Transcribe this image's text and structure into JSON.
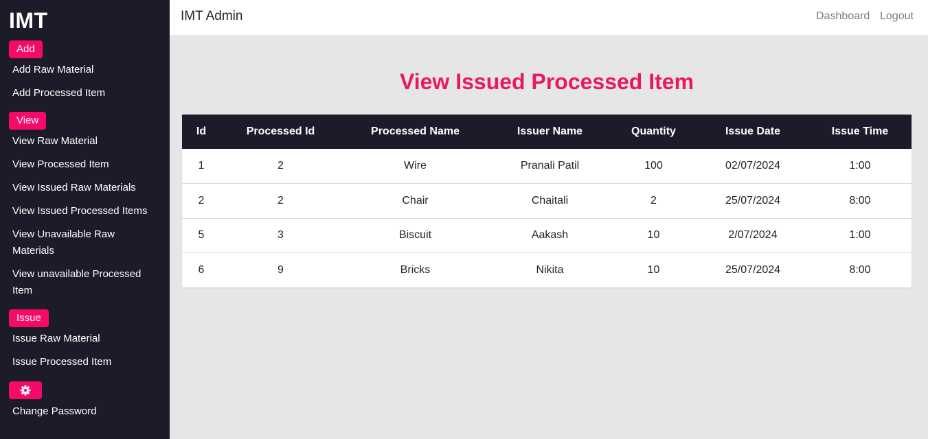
{
  "sidebar": {
    "brand": "IMT",
    "sections": {
      "add": {
        "badge": "Add",
        "items": [
          "Add Raw Material",
          "Add Processed Item"
        ]
      },
      "view": {
        "badge": "View",
        "items": [
          "View Raw Material",
          "View Processed Item",
          "View Issued Raw Materials",
          "View Issued Processed Items",
          "View Unavailable Raw Materials",
          "View unavailable Processed Item"
        ]
      },
      "issue": {
        "badge": "Issue",
        "items": [
          "Issue Raw Material",
          "Issue Processed Item"
        ]
      },
      "settings": {
        "icon": "gear-icon",
        "items": [
          "Change Password"
        ]
      }
    }
  },
  "header": {
    "title": "IMT Admin",
    "nav": [
      "Dashboard",
      "Logout"
    ]
  },
  "main": {
    "title": "View Issued Processed Item",
    "table": {
      "columns": [
        "Id",
        "Processed Id",
        "Processed Name",
        "Issuer Name",
        "Quantity",
        "Issue Date",
        "Issue Time"
      ],
      "rows": [
        [
          "1",
          "2",
          "Wire",
          "Pranali Patil",
          "100",
          "02/07/2024",
          "1:00"
        ],
        [
          "2",
          "2",
          "Chair",
          "Chaitali",
          "2",
          "25/07/2024",
          "8:00"
        ],
        [
          "5",
          "3",
          "Biscuit",
          "Aakash",
          "10",
          "2/07/2024",
          "1:00"
        ],
        [
          "6",
          "9",
          "Bricks",
          "Nikita",
          "10",
          "25/07/2024",
          "8:00"
        ]
      ]
    }
  },
  "colors": {
    "sidebar_bg": "#1c1b29",
    "accent": "#f50a6a",
    "title": "#e8195f",
    "background": "#e6e6e6"
  }
}
